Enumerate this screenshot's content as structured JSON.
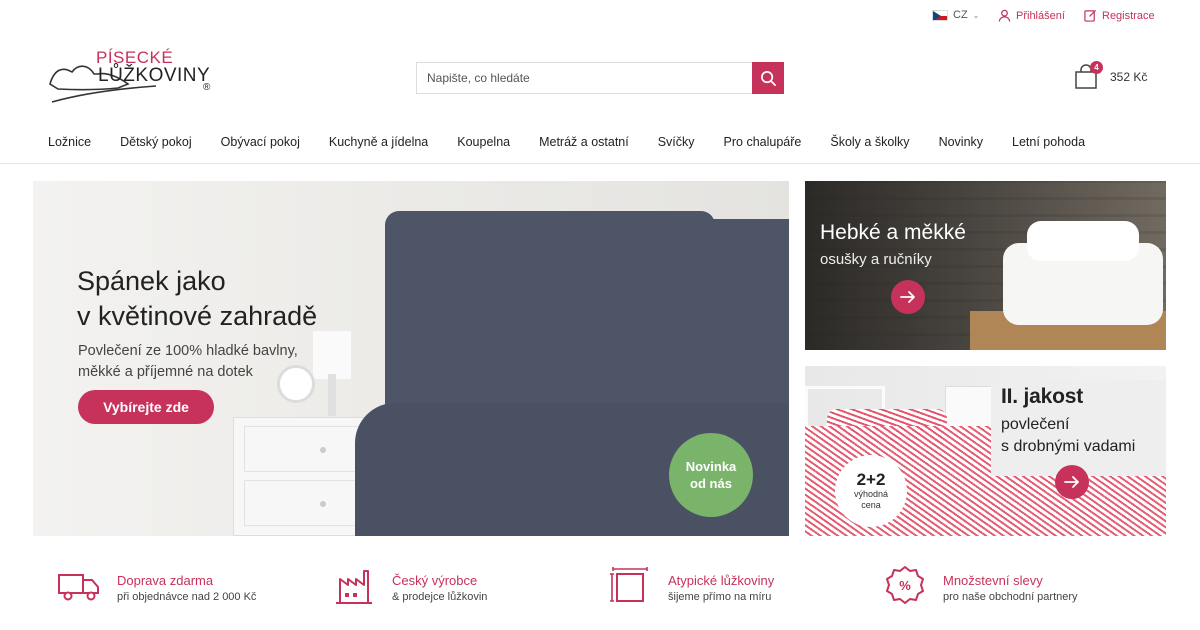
{
  "topbar": {
    "lang": "CZ",
    "login": "Přihlášení",
    "register": "Registrace"
  },
  "logo": {
    "line1": "PÍSECKÉ",
    "line2": "LŮŽKOVINY",
    "mark": "®"
  },
  "search": {
    "placeholder": "Napište, co hledáte"
  },
  "cart": {
    "count": "4",
    "total": "352 Kč"
  },
  "nav": [
    "Ložnice",
    "Dětský pokoj",
    "Obývací pokoj",
    "Kuchyně a jídelna",
    "Koupelna",
    "Metráž a ostatní",
    "Svíčky",
    "Pro chalupáře",
    "Školy a školky",
    "Novinky",
    "Letní pohoda"
  ],
  "hero": {
    "title_line1": "Spánek jako",
    "title_line2": "v květinové zahradě",
    "desc_line1": "Povlečení ze 100% hladké bavlny,",
    "desc_line2": "měkké a příjemné na dotek",
    "cta": "Vybírejte zde",
    "badge_line1": "Novinka",
    "badge_line2": "od nás"
  },
  "banner1": {
    "title": "Hebké a měkké",
    "subtitle": "osušky a ručníky"
  },
  "banner2": {
    "title": "II. jakost",
    "sub_line1": "povlečení",
    "sub_line2": "s drobnými vadami",
    "deal_big": "2+2",
    "deal_line1": "výhodná",
    "deal_line2": "cena"
  },
  "features": [
    {
      "title": "Doprava zdarma",
      "desc": "při objednávce nad 2 000 Kč",
      "icon": "truck-icon"
    },
    {
      "title": "Český výrobce",
      "desc": "& prodejce lůžkovin",
      "icon": "factory-icon"
    },
    {
      "title": "Atypické lůžkoviny",
      "desc": "šijeme přímo na míru",
      "icon": "dimensions-icon"
    },
    {
      "title": "Množstevní slevy",
      "desc": "pro naše obchodní partnery",
      "icon": "percent-badge-icon"
    }
  ],
  "colors": {
    "accent": "#c6325a",
    "badge_green": "#7ab36a"
  }
}
